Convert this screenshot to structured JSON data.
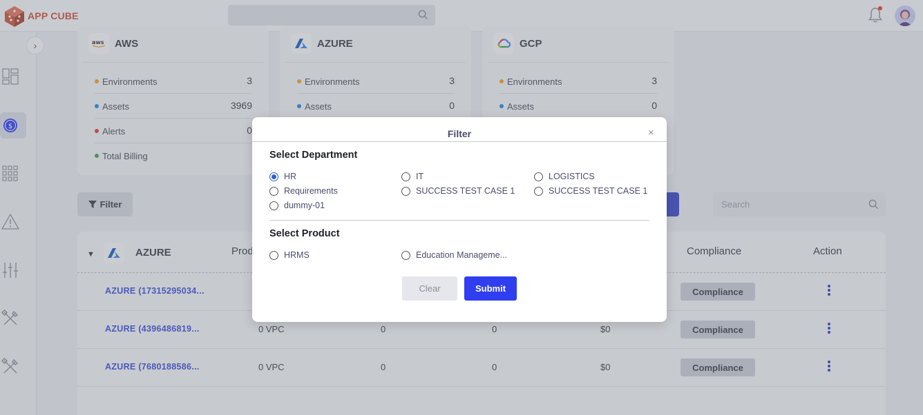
{
  "app": {
    "name": "APP CUBE"
  },
  "topbar": {
    "search_placeholder": ""
  },
  "cards": [
    {
      "name": "AWS",
      "rows": [
        {
          "label": "Environments",
          "value": "3",
          "color": "#f0a020"
        },
        {
          "label": "Assets",
          "value": "3969",
          "color": "#1e88e5"
        },
        {
          "label": "Alerts",
          "value": "0",
          "color": "#e53935"
        },
        {
          "label": "Total Billing",
          "value": "",
          "color": "#43a047"
        }
      ]
    },
    {
      "name": "AZURE",
      "rows": [
        {
          "label": "Environments",
          "value": "3",
          "color": "#f0a020"
        },
        {
          "label": "Assets",
          "value": "0",
          "color": "#1e88e5"
        }
      ]
    },
    {
      "name": "GCP",
      "rows": [
        {
          "label": "Environments",
          "value": "3",
          "color": "#f0a020"
        },
        {
          "label": "Assets",
          "value": "0",
          "color": "#1e88e5"
        }
      ]
    }
  ],
  "toolbar": {
    "filter_label": "Filter",
    "search_placeholder": "Search"
  },
  "table": {
    "group": "AZURE",
    "headers": {
      "product": "Produ",
      "compliance": "Compliance",
      "action": "Action"
    },
    "rows": [
      {
        "account": "AZURE (17315295034...",
        "product": "",
        "c3": "",
        "c4": "",
        "billing": "",
        "compliance": "Compliance"
      },
      {
        "account": "AZURE (4396486819...",
        "product": "0 VPC",
        "c3": "0",
        "c4": "0",
        "billing": "$0",
        "compliance": "Compliance"
      },
      {
        "account": "AZURE (7680188586...",
        "product": "0 VPC",
        "c3": "0",
        "c4": "0",
        "billing": "$0",
        "compliance": "Compliance"
      }
    ]
  },
  "modal": {
    "title": "Filter",
    "close": "×",
    "department_heading": "Select Department",
    "departments": [
      {
        "label": "HR",
        "checked": true
      },
      {
        "label": "IT",
        "checked": false
      },
      {
        "label": "LOGISTICS",
        "checked": false
      },
      {
        "label": "Requirements",
        "checked": false
      },
      {
        "label": "SUCCESS TEST CASE 1",
        "checked": false
      },
      {
        "label": "SUCCESS TEST CASE 1",
        "checked": false
      },
      {
        "label": "dummy-01",
        "checked": false
      }
    ],
    "product_heading": "Select Product",
    "products": [
      {
        "label": "HRMS",
        "checked": false
      },
      {
        "label": "Education Manageme...",
        "checked": false
      }
    ],
    "clear_label": "Clear",
    "submit_label": "Submit"
  },
  "colors": {
    "accent": "#2f3ef0",
    "link": "#3b4fd6",
    "brand": "#c9513a"
  }
}
